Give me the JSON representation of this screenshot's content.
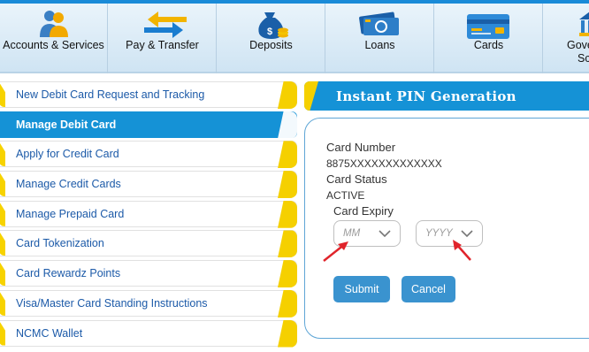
{
  "nav": [
    {
      "label": "Accounts & Services",
      "icon": "users-icon"
    },
    {
      "label": "Pay & Transfer",
      "icon": "transfer-arrows-icon"
    },
    {
      "label": "Deposits",
      "icon": "money-bag-icon"
    },
    {
      "label": "Loans",
      "icon": "cash-icon"
    },
    {
      "label": "Cards",
      "icon": "credit-card-icon"
    },
    {
      "label_line1": "Gove",
      "label_line2": "Sch",
      "icon": "government-icon"
    }
  ],
  "menu": [
    "New Debit Card Request and Tracking",
    "Manage Debit Card",
    "Apply for Credit Card",
    "Manage Credit Cards",
    "Manage Prepaid Card",
    "Card Tokenization",
    "Card Rewardz Points",
    "Visa/Master Card Standing Instructions",
    "NCMC Wallet"
  ],
  "active_menu_index": 1,
  "panel": {
    "title": "Instant PIN Generation",
    "card_number_label": "Card Number",
    "card_number_value": "8875XXXXXXXXXXXXX",
    "card_status_label": "Card Status",
    "card_status_value": "ACTIVE",
    "card_expiry_label": "Card Expiry",
    "month_placeholder": "MM",
    "year_placeholder": "YYYY",
    "submit_label": "Submit",
    "cancel_label": "Cancel"
  },
  "colors": {
    "accent_blue": "#1592d6",
    "accent_yellow": "#f5d000",
    "link_blue": "#1c5aa8",
    "button_blue": "#3a93cf",
    "arrow_red": "#e0242b"
  }
}
